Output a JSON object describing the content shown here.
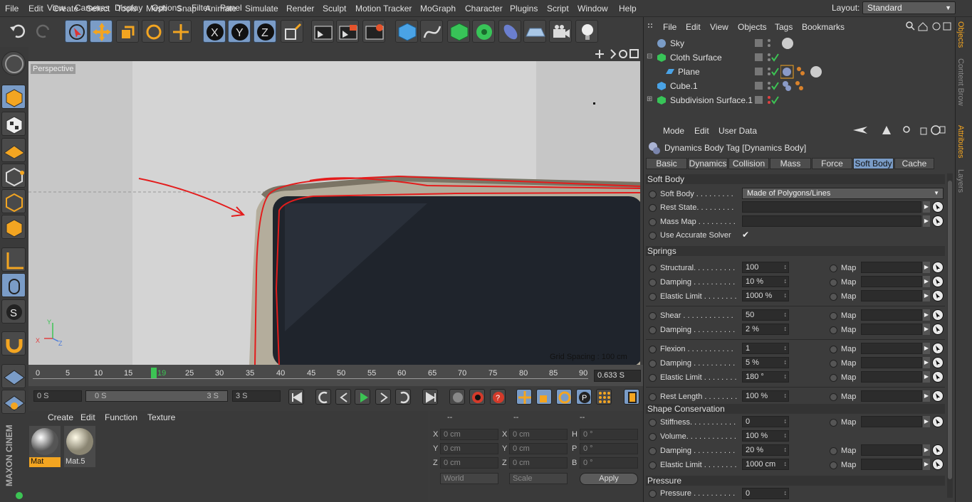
{
  "menubar": {
    "items": [
      "File",
      "Edit",
      "Create",
      "Select",
      "Tools",
      "Mesh",
      "Snap",
      "Animate",
      "Simulate",
      "Render",
      "Sculpt",
      "Motion Tracker",
      "MoGraph",
      "Character",
      "Plugins",
      "Script",
      "Window",
      "Help"
    ],
    "layout_label": "Layout:",
    "layout_value": "Standard"
  },
  "toolbar": {
    "icons": [
      "undo-icon",
      "redo-icon",
      "live-selection-icon",
      "move-icon",
      "scale-icon",
      "rotate-icon",
      "transform-icon",
      "x-axis-icon",
      "y-axis-icon",
      "z-axis-icon",
      "coordinate-system-icon",
      "render-region-icon",
      "render-to-picture-viewer-icon",
      "render-settings-icon",
      "cube-icon",
      "spline-pen-icon",
      "subdivision-surface-icon",
      "cloner-icon",
      "deformer-icon",
      "floor-icon",
      "camera-icon",
      "light-icon"
    ],
    "axis_x": "X",
    "axis_y": "Y",
    "axis_z": "Z"
  },
  "viewport": {
    "menu": [
      "View",
      "Cameras",
      "Display",
      "Options",
      "Filter",
      "Panel"
    ],
    "camera_label": "Perspective",
    "grid_spacing": "Grid Spacing : 100 cm"
  },
  "timeline": {
    "ticks": [
      "0",
      "5",
      "10",
      "15",
      "19",
      "25",
      "30",
      "35",
      "40",
      "45",
      "50",
      "55",
      "60",
      "65",
      "70",
      "75",
      "80",
      "85",
      "90"
    ],
    "current_frame": "19",
    "time_value": "0.633 S"
  },
  "transport": {
    "start": "0 S",
    "range_start": "0 S",
    "range_end": "3 S",
    "end": "3 S"
  },
  "materials": {
    "menu": [
      "Create",
      "Edit",
      "Function",
      "Texture"
    ],
    "items": [
      {
        "name": "Mat"
      },
      {
        "name": "Mat.5"
      }
    ]
  },
  "coords": {
    "headers": [
      "--",
      "--",
      "--"
    ],
    "rows": [
      {
        "l1": "X",
        "v1": "0 cm",
        "l2": "X",
        "v2": "0 cm",
        "l3": "H",
        "v3": "0 °"
      },
      {
        "l1": "Y",
        "v1": "0 cm",
        "l2": "Y",
        "v2": "0 cm",
        "l3": "P",
        "v3": "0 °"
      },
      {
        "l1": "Z",
        "v1": "0 cm",
        "l2": "Z",
        "v2": "0 cm",
        "l3": "B",
        "v3": "0 °"
      }
    ],
    "mode_world": "World",
    "mode_scale": "Scale",
    "apply": "Apply"
  },
  "objects": {
    "menu": [
      "File",
      "Edit",
      "View",
      "Objects",
      "Tags",
      "Bookmarks"
    ],
    "rows": [
      {
        "name": "Sky"
      },
      {
        "name": "Cloth Surface"
      },
      {
        "name": "Plane"
      },
      {
        "name": "Cube.1"
      },
      {
        "name": "Subdivision Surface.1"
      }
    ]
  },
  "attributes": {
    "menu": [
      "Mode",
      "Edit",
      "User Data"
    ],
    "title": "Dynamics Body Tag [Dynamics Body]",
    "tabs": [
      "Basic",
      "Dynamics",
      "Collision",
      "Mass",
      "Force",
      "Soft Body",
      "Cache"
    ],
    "active_tab": "Soft Body",
    "section_soft_body": "Soft Body",
    "soft_body_label": "Soft Body . . . . . . . . .",
    "soft_body_value": "Made of Polygons/Lines",
    "rest_state": "Rest State. . . . . . . . .",
    "mass_map": "Mass Map . . . . . . . . .",
    "accurate_solver": "Use Accurate Solver",
    "accurate_solver_check": "✔",
    "section_springs": "Springs",
    "springs": [
      {
        "label": "Structural. . . . . . . . . .",
        "value": "100"
      },
      {
        "label": "Damping . . . . . . . . . .",
        "value": "10 %"
      },
      {
        "label": "Elastic Limit . . . . . . . .",
        "value": "1000 %"
      },
      {
        "label": "Shear . . . . . . . . . . . .",
        "value": "50"
      },
      {
        "label": "Damping . . . . . . . . . .",
        "value": "2 %"
      },
      {
        "label": "Flexion . . . . . . . . . . .",
        "value": "1"
      },
      {
        "label": "Damping . . . . . . . . . .",
        "value": "5 %"
      },
      {
        "label": "Elastic Limit . . . . . . . .",
        "value": "180 °"
      },
      {
        "label": "Rest Length . . . . . . . .",
        "value": "100 %"
      }
    ],
    "map_label": "Map",
    "section_shape": "Shape Conservation",
    "shape": [
      {
        "label": "Stiffness. . . . . . . . . . .",
        "value": "0"
      },
      {
        "label": "Volume. . . . . . . . . . . .",
        "value": "100 %"
      },
      {
        "label": "Damping . . . . . . . . . .",
        "value": "20 %"
      },
      {
        "label": "Elastic Limit . . . . . . . .",
        "value": "1000 cm"
      }
    ],
    "section_pressure": "Pressure",
    "pressure_label": "Pressure . . . . . . . . . .",
    "pressure_value": "0"
  },
  "side_tabs": [
    "Objects",
    "Content Brow",
    "Attributes",
    "Layers"
  ],
  "brand": "MAXON CINEMA 4D"
}
